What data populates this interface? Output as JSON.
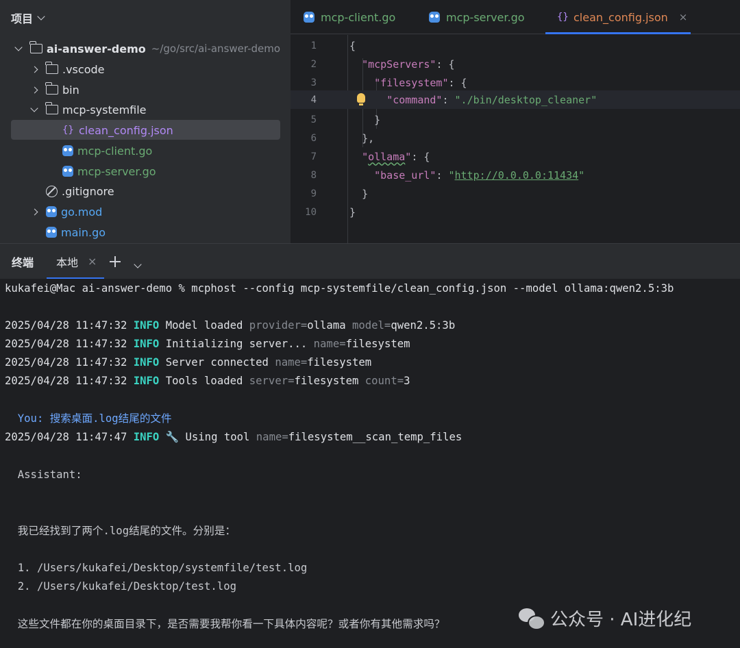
{
  "project": {
    "header": "项目",
    "root": {
      "name": "ai-answer-demo",
      "path": "~/go/src/ai-answer-demo"
    },
    "items": [
      {
        "label": ".vscode"
      },
      {
        "label": "bin"
      },
      {
        "label": "mcp-systemfile"
      },
      {
        "label": "clean_config.json"
      },
      {
        "label": "mcp-client.go"
      },
      {
        "label": "mcp-server.go"
      },
      {
        "label": ".gitignore"
      },
      {
        "label": "go.mod"
      },
      {
        "label": "main.go"
      }
    ]
  },
  "tabs": [
    {
      "label": "mcp-client.go"
    },
    {
      "label": "mcp-server.go"
    },
    {
      "label": "clean_config.json",
      "close": "×"
    }
  ],
  "editor": {
    "line_numbers": [
      "1",
      "2",
      "3",
      "4",
      "5",
      "6",
      "7",
      "8",
      "9",
      "10"
    ],
    "l1": "{",
    "l2_key": "\"mcpServers\"",
    "l2_rest": ": {",
    "l3_key": "\"filesystem\"",
    "l3_rest": ": {",
    "l4_key": "\"command\"",
    "l4_colon": ": ",
    "l4_val": "\"./bin/desktop_cleaner\"",
    "l5": "}",
    "l6": "},",
    "l7_q1": "\"",
    "l7_key": "ollama",
    "l7_q2": "\"",
    "l7_rest": ": {",
    "l8_key": "\"base_url\"",
    "l8_colon": ": ",
    "l8_q1": "\"",
    "l8_url": "http://0.0.0.0:11434",
    "l8_q2": "\"",
    "l9": "}",
    "l10": "}"
  },
  "terminal_bar": {
    "title": "终端",
    "tab": "本地",
    "close": "×"
  },
  "terminal": {
    "cmd": "kukafei@Mac ai-answer-demo % mcphost --config mcp-systemfile/clean_config.json --model ollama:qwen2.5:3b",
    "logs": [
      {
        "ts": "2025/04/28 11:47:32 ",
        "lvl": "INFO",
        "msg": " Model loaded ",
        "k1": "provider=",
        "v1": "ollama ",
        "k2": "model=",
        "v2": "qwen2.5:3b"
      },
      {
        "ts": "2025/04/28 11:47:32 ",
        "lvl": "INFO",
        "msg": " Initializing server... ",
        "k1": "name=",
        "v1": "filesystem"
      },
      {
        "ts": "2025/04/28 11:47:32 ",
        "lvl": "INFO",
        "msg": " Server connected ",
        "k1": "name=",
        "v1": "filesystem"
      },
      {
        "ts": "2025/04/28 11:47:32 ",
        "lvl": "INFO",
        "msg": " Tools loaded ",
        "k1": "server=",
        "v1": "filesystem ",
        "k2": "count=",
        "v2": "3"
      }
    ],
    "you": "  You: 搜索桌面.log结尾的文件",
    "tool_log": {
      "ts": "2025/04/28 11:47:47 ",
      "lvl": "INFO",
      "msg": " 🔧 Using tool ",
      "k1": "name=",
      "v1": "filesystem__scan_temp_files"
    },
    "assistant": "  Assistant:",
    "answer": "  我已经找到了两个.log结尾的文件。分别是：",
    "item1": "  1. /Users/kukafei/Desktop/systemfile/test.log",
    "item2": "  2. /Users/kukafei/Desktop/test.log",
    "question": "  这些文件都在你的桌面目录下，是否需要我帮你看一下具体内容呢？或者你有其他需求吗？"
  },
  "watermark": "公众号 · AI进化纪"
}
